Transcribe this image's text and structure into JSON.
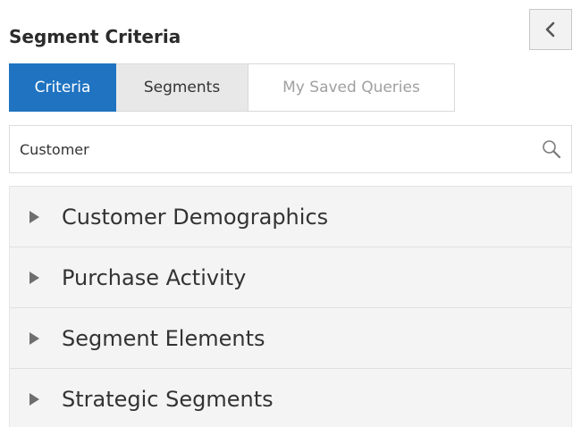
{
  "panel": {
    "title": "Segment Criteria",
    "collapse_icon": "chevron-left-icon"
  },
  "tabs": [
    {
      "label": "Criteria",
      "state": "selected"
    },
    {
      "label": "Segments",
      "state": "normal"
    },
    {
      "label": "My Saved Queries",
      "state": "disabled"
    }
  ],
  "search": {
    "value": "Customer",
    "icon": "search-icon"
  },
  "accordion": {
    "items": [
      {
        "label": "Customer Demographics",
        "icon": "triangle-right-icon"
      },
      {
        "label": "Purchase Activity",
        "icon": "triangle-right-icon"
      },
      {
        "label": "Segment Elements",
        "icon": "triangle-right-icon"
      },
      {
        "label": "Strategic Segments",
        "icon": "triangle-right-icon"
      }
    ]
  },
  "colors": {
    "accent": "#1f73c1",
    "tab_inactive_bg": "#e8e8e8",
    "accordion_bg": "#f4f4f5"
  }
}
